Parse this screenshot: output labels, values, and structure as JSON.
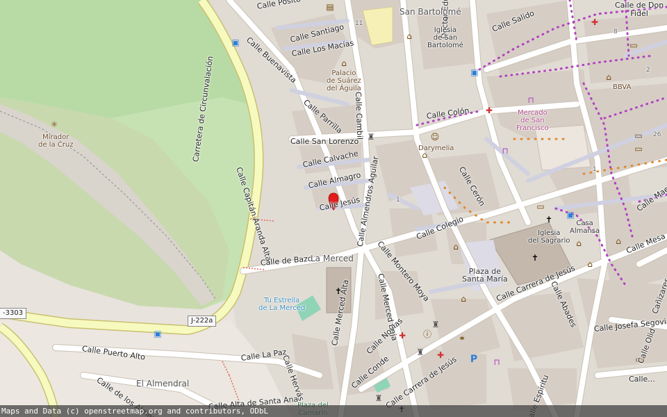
{
  "streets": {
    "posito": "Calle Posito",
    "buenavista": "Calle Buenavista",
    "santiago": "Calle Santiago",
    "los_macias": "Calle Los Macías",
    "parrilla": "Calle Parrilla",
    "cambil": "Calle Cambil",
    "salido": "Calle Salido",
    "eduardo_arroyo": "Doctor Eduardo Arroyo",
    "colon": "Calle Colón",
    "san_lorenzo": "Calle San Lorenzo",
    "capitan_aranda": "Calle Capitán Aranda Alta",
    "circunvalacion": "Carretera de Circunvalación",
    "calvache": "Calle Calvache",
    "almagro": "Calle Almagro",
    "almendros": "Calle Almendros Aguilar",
    "jesus": "Calle Jesús",
    "ceron": "Calle Cerón",
    "montero_moya": "Calle Montero Moya",
    "colegio": "Calle Colegio",
    "bazo": "Calle de Bazo",
    "merced_alta": "Calle Merced Alta",
    "merced_baja": "Calle Merced Baja",
    "carrera_jesus_1": "Calle Carrera de Jesús",
    "abades": "Calle Abades",
    "puerto_alto": "Calle Puerto Alto",
    "la_paz": "Calle La Paz",
    "hervas": "Calle Hervás",
    "novias": "Calle Novias",
    "conde": "Calle Conde",
    "carrera_jesus_2": "Calle Carrera de Jesús",
    "los_almendros": "Calle de los Almendros",
    "alta_santa_ana": "Calle Alta de Santa Ana",
    "josefa_segovia": "Calle Josefa Segovia",
    "mesa": "Calle Mesa",
    "olid": "Calle Olid",
    "canizares": "Cañizares",
    "espiritu": "Calle Espíritu",
    "maestra": "Calle Mae...",
    "don_fidel": "Calle de Don\nFidel",
    "calle_f": "Calle..."
  },
  "places": {
    "san_bartolome": "San Bartolomé",
    "iglesia_san_bartolome": "Iglesia\nde San\nBartolomé",
    "palacio": "Palacio\nde Suárez\ndel Águila",
    "mercado": "Mercado\nde San\nFrancisco",
    "darymelia": "Darymelia",
    "mirador": "Mirador\nde la Cruz",
    "la_merced": "La Merced",
    "el_almendral": "El Almendral",
    "iglesia_sagrario": "Iglesia\ndel Sagrario",
    "plaza_santa_maria": "Plaza de\nSanta María",
    "casa_almansa": "Casa\nAlmansa",
    "bbva": "BBVA",
    "fuente": "Tu Estrella\nde La Merced",
    "plaza_camarin": "Plaza del\nCamarín"
  },
  "road_refs": {
    "j222a": "J-222a",
    "a3303": "-3303"
  },
  "house_numbers": {
    "n11": "11",
    "n8": "8",
    "n2": "2",
    "n26": "26",
    "n1a": "1",
    "n1b": "1"
  },
  "attribution": "Maps and Data (c) openstreetmap.org and contributors, ODbL",
  "colors": {
    "park": "#add19e",
    "scrub": "#c8d7ab",
    "rock": "#d7d1c7",
    "building": "#d9d0c9",
    "road": "#ffffff",
    "secondary_road": "#f7fabf",
    "casing": "#c7bda5",
    "pedestrian": "#dddde8",
    "cycle_dots": "#b040c0"
  },
  "icons": {
    "church": "cross-icon",
    "pharmacy": "pharmacy-icon",
    "museum": "museum-icon",
    "bus": "bus-stop-icon",
    "bank": "bank-icon",
    "parking": "parking-icon",
    "viewpoint": "viewpoint-icon",
    "marker": "location-marker-icon"
  }
}
